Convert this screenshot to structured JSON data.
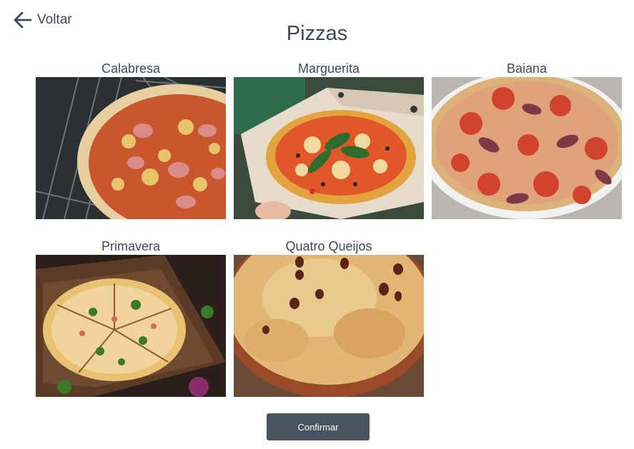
{
  "header": {
    "back_label": "Voltar",
    "title": "Pizzas"
  },
  "pizzas": [
    {
      "label": "Calabresa"
    },
    {
      "label": "Marguerita"
    },
    {
      "label": "Baiana"
    },
    {
      "label": "Primavera"
    },
    {
      "label": "Quatro Queijos"
    }
  ],
  "actions": {
    "confirm_label": "Confirmar"
  },
  "icons": {
    "back": "arrow-left-icon"
  },
  "colors": {
    "text": "#3f4857",
    "button": "#4a5360",
    "button_text": "#ffffff"
  }
}
